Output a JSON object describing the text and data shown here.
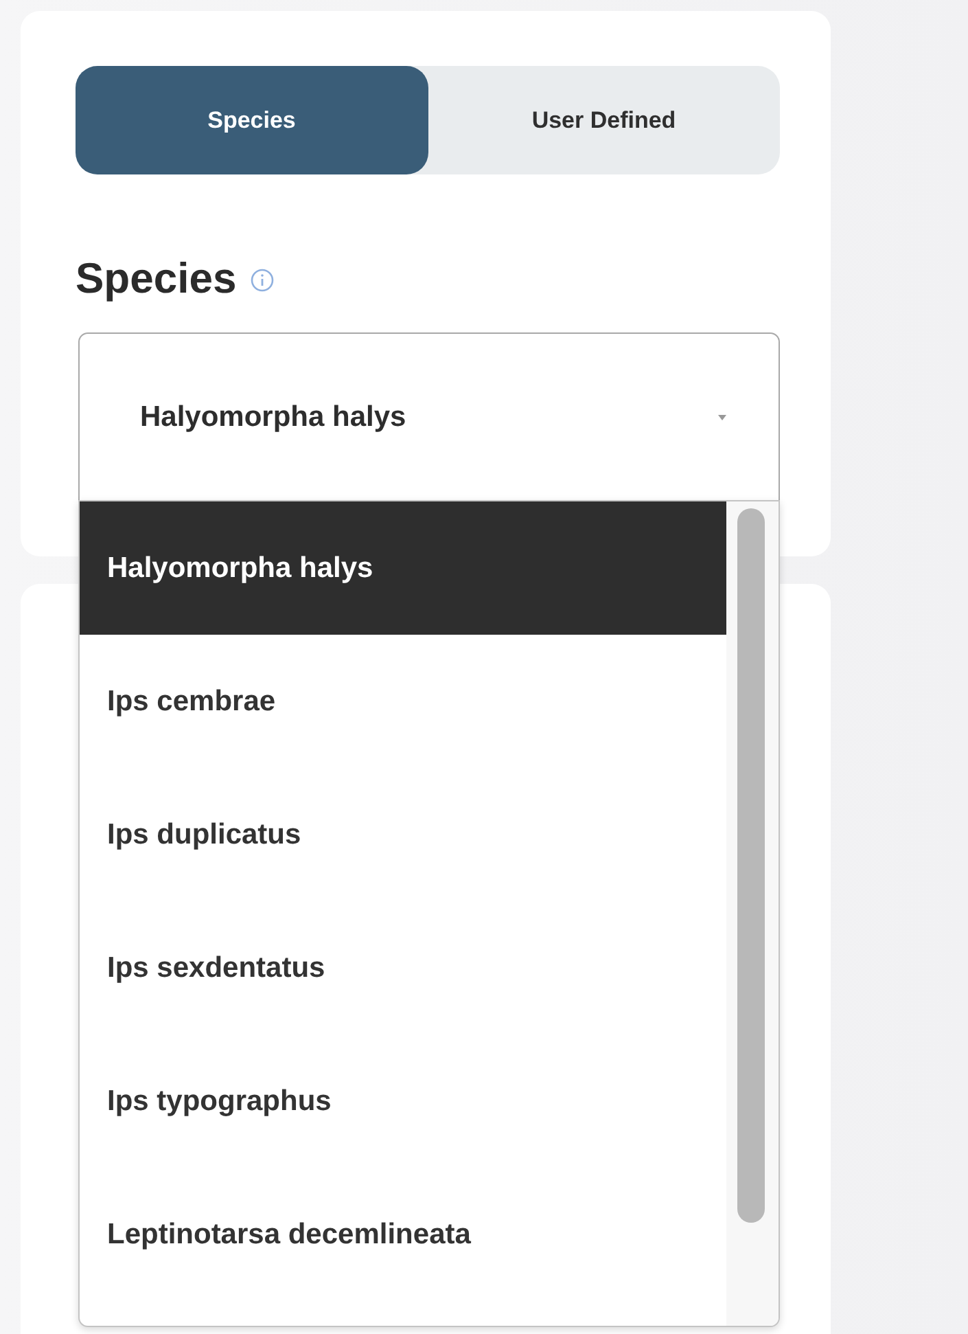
{
  "tabs": [
    {
      "label": "Species",
      "selected": true
    },
    {
      "label": "User Defined",
      "selected": false
    }
  ],
  "species_field": {
    "label": "Species",
    "value": "Halyomorpha halys",
    "expanded": true
  },
  "dropdown_options": [
    {
      "label": "Halyomorpha halys",
      "selected": true
    },
    {
      "label": "Ips cembrae",
      "selected": false
    },
    {
      "label": "Ips duplicatus",
      "selected": false
    },
    {
      "label": "Ips sexdentatus",
      "selected": false
    },
    {
      "label": "Ips typographus",
      "selected": false
    },
    {
      "label": "Leptinotarsa decemlineata",
      "selected": false
    }
  ]
}
